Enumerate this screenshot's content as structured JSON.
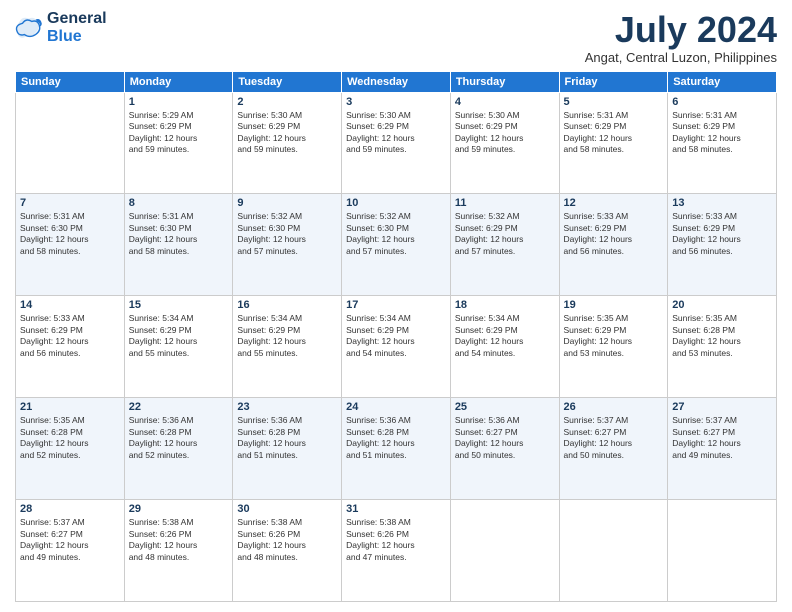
{
  "logo": {
    "line1": "General",
    "line2": "Blue"
  },
  "title": "July 2024",
  "location": "Angat, Central Luzon, Philippines",
  "headers": [
    "Sunday",
    "Monday",
    "Tuesday",
    "Wednesday",
    "Thursday",
    "Friday",
    "Saturday"
  ],
  "weeks": [
    [
      {
        "day": "",
        "info": ""
      },
      {
        "day": "1",
        "info": "Sunrise: 5:29 AM\nSunset: 6:29 PM\nDaylight: 12 hours\nand 59 minutes."
      },
      {
        "day": "2",
        "info": "Sunrise: 5:30 AM\nSunset: 6:29 PM\nDaylight: 12 hours\nand 59 minutes."
      },
      {
        "day": "3",
        "info": "Sunrise: 5:30 AM\nSunset: 6:29 PM\nDaylight: 12 hours\nand 59 minutes."
      },
      {
        "day": "4",
        "info": "Sunrise: 5:30 AM\nSunset: 6:29 PM\nDaylight: 12 hours\nand 59 minutes."
      },
      {
        "day": "5",
        "info": "Sunrise: 5:31 AM\nSunset: 6:29 PM\nDaylight: 12 hours\nand 58 minutes."
      },
      {
        "day": "6",
        "info": "Sunrise: 5:31 AM\nSunset: 6:29 PM\nDaylight: 12 hours\nand 58 minutes."
      }
    ],
    [
      {
        "day": "7",
        "info": "Sunrise: 5:31 AM\nSunset: 6:30 PM\nDaylight: 12 hours\nand 58 minutes."
      },
      {
        "day": "8",
        "info": "Sunrise: 5:31 AM\nSunset: 6:30 PM\nDaylight: 12 hours\nand 58 minutes."
      },
      {
        "day": "9",
        "info": "Sunrise: 5:32 AM\nSunset: 6:30 PM\nDaylight: 12 hours\nand 57 minutes."
      },
      {
        "day": "10",
        "info": "Sunrise: 5:32 AM\nSunset: 6:30 PM\nDaylight: 12 hours\nand 57 minutes."
      },
      {
        "day": "11",
        "info": "Sunrise: 5:32 AM\nSunset: 6:29 PM\nDaylight: 12 hours\nand 57 minutes."
      },
      {
        "day": "12",
        "info": "Sunrise: 5:33 AM\nSunset: 6:29 PM\nDaylight: 12 hours\nand 56 minutes."
      },
      {
        "day": "13",
        "info": "Sunrise: 5:33 AM\nSunset: 6:29 PM\nDaylight: 12 hours\nand 56 minutes."
      }
    ],
    [
      {
        "day": "14",
        "info": "Sunrise: 5:33 AM\nSunset: 6:29 PM\nDaylight: 12 hours\nand 56 minutes."
      },
      {
        "day": "15",
        "info": "Sunrise: 5:34 AM\nSunset: 6:29 PM\nDaylight: 12 hours\nand 55 minutes."
      },
      {
        "day": "16",
        "info": "Sunrise: 5:34 AM\nSunset: 6:29 PM\nDaylight: 12 hours\nand 55 minutes."
      },
      {
        "day": "17",
        "info": "Sunrise: 5:34 AM\nSunset: 6:29 PM\nDaylight: 12 hours\nand 54 minutes."
      },
      {
        "day": "18",
        "info": "Sunrise: 5:34 AM\nSunset: 6:29 PM\nDaylight: 12 hours\nand 54 minutes."
      },
      {
        "day": "19",
        "info": "Sunrise: 5:35 AM\nSunset: 6:29 PM\nDaylight: 12 hours\nand 53 minutes."
      },
      {
        "day": "20",
        "info": "Sunrise: 5:35 AM\nSunset: 6:28 PM\nDaylight: 12 hours\nand 53 minutes."
      }
    ],
    [
      {
        "day": "21",
        "info": "Sunrise: 5:35 AM\nSunset: 6:28 PM\nDaylight: 12 hours\nand 52 minutes."
      },
      {
        "day": "22",
        "info": "Sunrise: 5:36 AM\nSunset: 6:28 PM\nDaylight: 12 hours\nand 52 minutes."
      },
      {
        "day": "23",
        "info": "Sunrise: 5:36 AM\nSunset: 6:28 PM\nDaylight: 12 hours\nand 51 minutes."
      },
      {
        "day": "24",
        "info": "Sunrise: 5:36 AM\nSunset: 6:28 PM\nDaylight: 12 hours\nand 51 minutes."
      },
      {
        "day": "25",
        "info": "Sunrise: 5:36 AM\nSunset: 6:27 PM\nDaylight: 12 hours\nand 50 minutes."
      },
      {
        "day": "26",
        "info": "Sunrise: 5:37 AM\nSunset: 6:27 PM\nDaylight: 12 hours\nand 50 minutes."
      },
      {
        "day": "27",
        "info": "Sunrise: 5:37 AM\nSunset: 6:27 PM\nDaylight: 12 hours\nand 49 minutes."
      }
    ],
    [
      {
        "day": "28",
        "info": "Sunrise: 5:37 AM\nSunset: 6:27 PM\nDaylight: 12 hours\nand 49 minutes."
      },
      {
        "day": "29",
        "info": "Sunrise: 5:38 AM\nSunset: 6:26 PM\nDaylight: 12 hours\nand 48 minutes."
      },
      {
        "day": "30",
        "info": "Sunrise: 5:38 AM\nSunset: 6:26 PM\nDaylight: 12 hours\nand 48 minutes."
      },
      {
        "day": "31",
        "info": "Sunrise: 5:38 AM\nSunset: 6:26 PM\nDaylight: 12 hours\nand 47 minutes."
      },
      {
        "day": "",
        "info": ""
      },
      {
        "day": "",
        "info": ""
      },
      {
        "day": "",
        "info": ""
      }
    ]
  ]
}
